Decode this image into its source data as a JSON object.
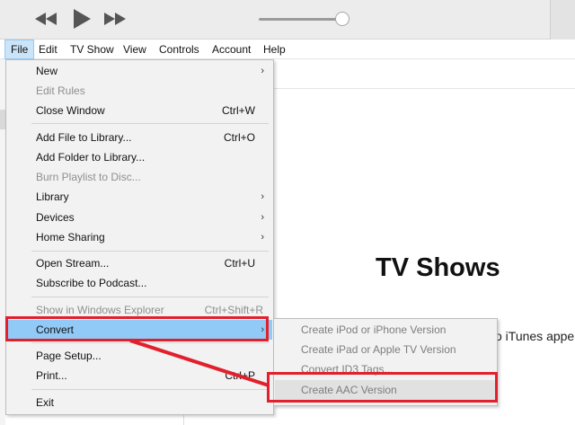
{
  "player": {
    "rewind_icon": "rewind-icon",
    "play_icon": "play-icon",
    "forward_icon": "fast-forward-icon",
    "volume_level": 0.87
  },
  "menubar": {
    "items": [
      "File",
      "Edit",
      "TV Show",
      "View",
      "Controls",
      "Account",
      "Help"
    ]
  },
  "file_menu": {
    "items": [
      {
        "label": "New",
        "submenu": true
      },
      {
        "label": "Edit Rules",
        "disabled": true
      },
      {
        "label": "Close Window",
        "shortcut": "Ctrl+W"
      },
      {
        "label": "Add File to Library...",
        "shortcut": "Ctrl+O"
      },
      {
        "label": "Add Folder to Library..."
      },
      {
        "label": "Burn Playlist to Disc...",
        "disabled": true
      },
      {
        "label": "Library",
        "submenu": true
      },
      {
        "label": "Devices",
        "submenu": true
      },
      {
        "label": "Home Sharing",
        "submenu": true
      },
      {
        "label": "Open Stream...",
        "shortcut": "Ctrl+U"
      },
      {
        "label": "Subscribe to Podcast..."
      },
      {
        "label": "Show in Windows Explorer",
        "shortcut": "Ctrl+Shift+R",
        "disabled": true
      },
      {
        "label": "Convert",
        "submenu": true,
        "highlighted": true
      },
      {
        "label": "Page Setup..."
      },
      {
        "label": "Print...",
        "shortcut": "Ctrl+P"
      },
      {
        "label": "Exit"
      }
    ],
    "arrow_glyph": "›"
  },
  "convert_submenu": {
    "items": [
      "Create iPod or iPhone Version",
      "Create iPad or Apple TV Version",
      "Convert ID3 Tags...",
      "Create AAC Version"
    ]
  },
  "background": {
    "title": "TV Shows",
    "text_fragment": "o iTunes appe"
  },
  "colors": {
    "annotation_red": "#e2202c",
    "menu_highlight": "#91c9f7",
    "menubar_active": "#cce4f7"
  }
}
